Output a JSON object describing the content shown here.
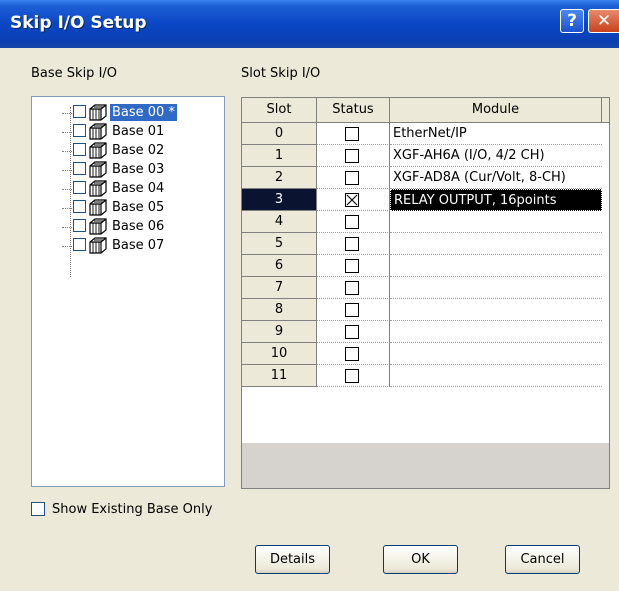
{
  "window": {
    "title": "Skip I/O Setup",
    "help_glyph": "?",
    "close_glyph": "✕"
  },
  "base_panel": {
    "label": "Base Skip I/O",
    "bases": [
      {
        "label": "Base 00 *",
        "selected": true
      },
      {
        "label": "Base 01"
      },
      {
        "label": "Base 02"
      },
      {
        "label": "Base 03"
      },
      {
        "label": "Base 04"
      },
      {
        "label": "Base 05"
      },
      {
        "label": "Base 06"
      },
      {
        "label": "Base 07"
      }
    ]
  },
  "slot_panel": {
    "label": "Slot Skip I/O",
    "columns": [
      "Slot",
      "Status",
      "Module"
    ],
    "rows": [
      {
        "slot": "0",
        "checked": false,
        "module": "EtherNet/IP"
      },
      {
        "slot": "1",
        "checked": false,
        "module": "XGF-AH6A (I/O, 4/2 CH)"
      },
      {
        "slot": "2",
        "checked": false,
        "module": "XGF-AD8A (Cur/Volt, 8-CH)"
      },
      {
        "slot": "3",
        "checked": true,
        "module": "RELAY OUTPUT, 16points",
        "selected": true
      },
      {
        "slot": "4",
        "checked": false,
        "module": ""
      },
      {
        "slot": "5",
        "checked": false,
        "module": ""
      },
      {
        "slot": "6",
        "checked": false,
        "module": ""
      },
      {
        "slot": "7",
        "checked": false,
        "module": ""
      },
      {
        "slot": "8",
        "checked": false,
        "module": ""
      },
      {
        "slot": "9",
        "checked": false,
        "module": ""
      },
      {
        "slot": "10",
        "checked": false,
        "module": ""
      },
      {
        "slot": "11",
        "checked": false,
        "module": ""
      }
    ]
  },
  "show_existing": {
    "label": "Show Existing Base Only",
    "checked": false
  },
  "buttons": {
    "details": "Details",
    "ok": "OK",
    "cancel": "Cancel"
  }
}
